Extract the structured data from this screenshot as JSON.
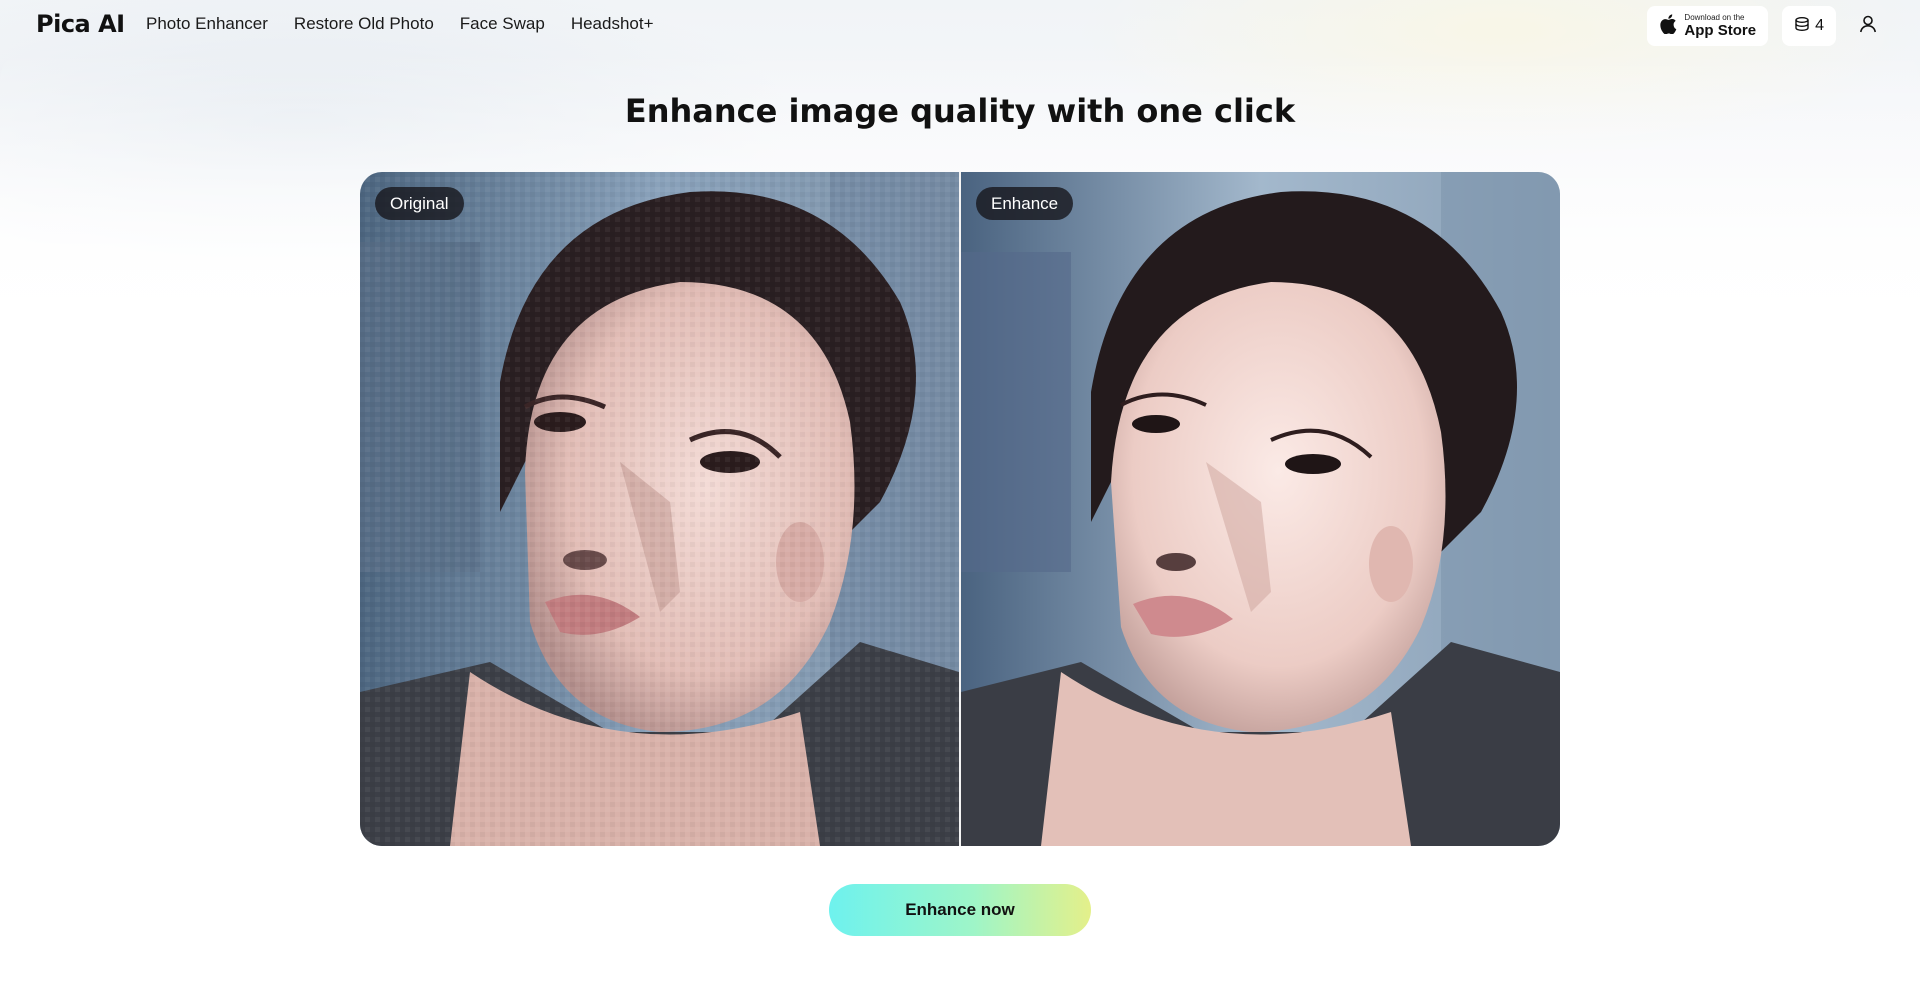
{
  "brand": {
    "name": "Pica AI"
  },
  "nav": {
    "links": [
      "Photo Enhancer",
      "Restore Old Photo",
      "Face Swap",
      "Headshot+"
    ]
  },
  "appstore": {
    "small_text": "Download on the",
    "big_text": "App Store",
    "icon": "apple-icon"
  },
  "credits": {
    "count": "4",
    "icon": "coins-stack-icon"
  },
  "user": {
    "icon": "user-icon"
  },
  "main": {
    "headline": "Enhance image quality with one click",
    "before_label": "Original",
    "after_label": "Enhance",
    "cta_label": "Enhance now"
  },
  "colors": {
    "cta_gradient_start": "#6ef2ee",
    "cta_gradient_end": "#e4f08a",
    "tag_background": "#1f1f24"
  }
}
